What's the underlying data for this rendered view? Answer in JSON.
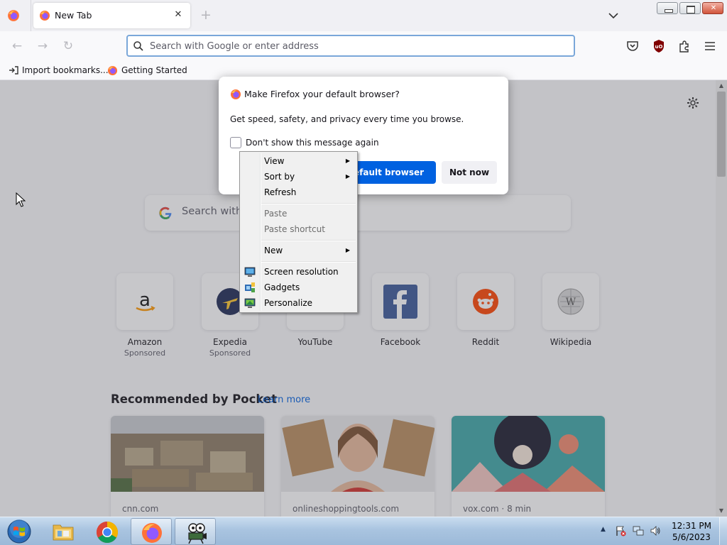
{
  "browser": {
    "tab": {
      "title": "New Tab"
    },
    "urlbar": {
      "placeholder": "Search with Google or enter address",
      "value": ""
    },
    "bookmarks": [
      {
        "label": "Import bookmarks...",
        "icon": "import-icon"
      },
      {
        "label": "Getting Started",
        "icon": "firefox-icon"
      }
    ]
  },
  "newtab": {
    "search_placeholder": "Search with",
    "top_sites": [
      {
        "name": "Amazon",
        "sponsored": "Sponsored",
        "icon": "amazon-icon"
      },
      {
        "name": "Expedia",
        "sponsored": "Sponsored",
        "icon": "expedia-icon"
      },
      {
        "name": "YouTube",
        "sponsored": "",
        "icon": "youtube-icon"
      },
      {
        "name": "Facebook",
        "sponsored": "",
        "icon": "facebook-icon"
      },
      {
        "name": "Reddit",
        "sponsored": "",
        "icon": "reddit-icon"
      },
      {
        "name": "Wikipedia",
        "sponsored": "",
        "icon": "wikipedia-icon"
      }
    ],
    "pocket": {
      "heading": "Recommended by Pocket",
      "learn_more": "Learn more",
      "cards": [
        {
          "source": "cnn.com"
        },
        {
          "source": "onlineshoppingtools.com"
        },
        {
          "source": "vox.com · 8 min"
        }
      ]
    }
  },
  "dialog": {
    "title": "Make Firefox your default browser?",
    "body": "Get speed, safety, and privacy every time you browse.",
    "checkbox_label": "Don't show this message again",
    "checkbox_checked": false,
    "primary_button": "as default browser",
    "secondary_button": "Not now",
    "accent_color": "#0061e0"
  },
  "context_menu": {
    "items": [
      {
        "label": "View",
        "submenu": true,
        "enabled": true
      },
      {
        "label": "Sort by",
        "submenu": true,
        "enabled": true
      },
      {
        "label": "Refresh",
        "submenu": false,
        "enabled": true
      },
      {
        "label": "Paste",
        "submenu": false,
        "enabled": false
      },
      {
        "label": "Paste shortcut",
        "submenu": false,
        "enabled": false
      },
      {
        "label": "New",
        "submenu": true,
        "enabled": true
      },
      {
        "label": "Screen resolution",
        "submenu": false,
        "enabled": true,
        "icon": "screen-resolution-icon"
      },
      {
        "label": "Gadgets",
        "submenu": false,
        "enabled": true,
        "icon": "gadgets-icon"
      },
      {
        "label": "Personalize",
        "submenu": false,
        "enabled": true,
        "icon": "personalize-icon"
      }
    ]
  },
  "taskbar": {
    "apps": [
      {
        "name": "Windows Explorer",
        "icon": "folder-icon",
        "active": false
      },
      {
        "name": "Google Chrome",
        "icon": "chrome-icon",
        "active": false
      },
      {
        "name": "Firefox",
        "icon": "firefox-icon",
        "active": true
      },
      {
        "name": "Media app",
        "icon": "projector-icon",
        "active": false
      }
    ],
    "clock": {
      "time": "12:31 PM",
      "date": "5/6/2023"
    }
  }
}
